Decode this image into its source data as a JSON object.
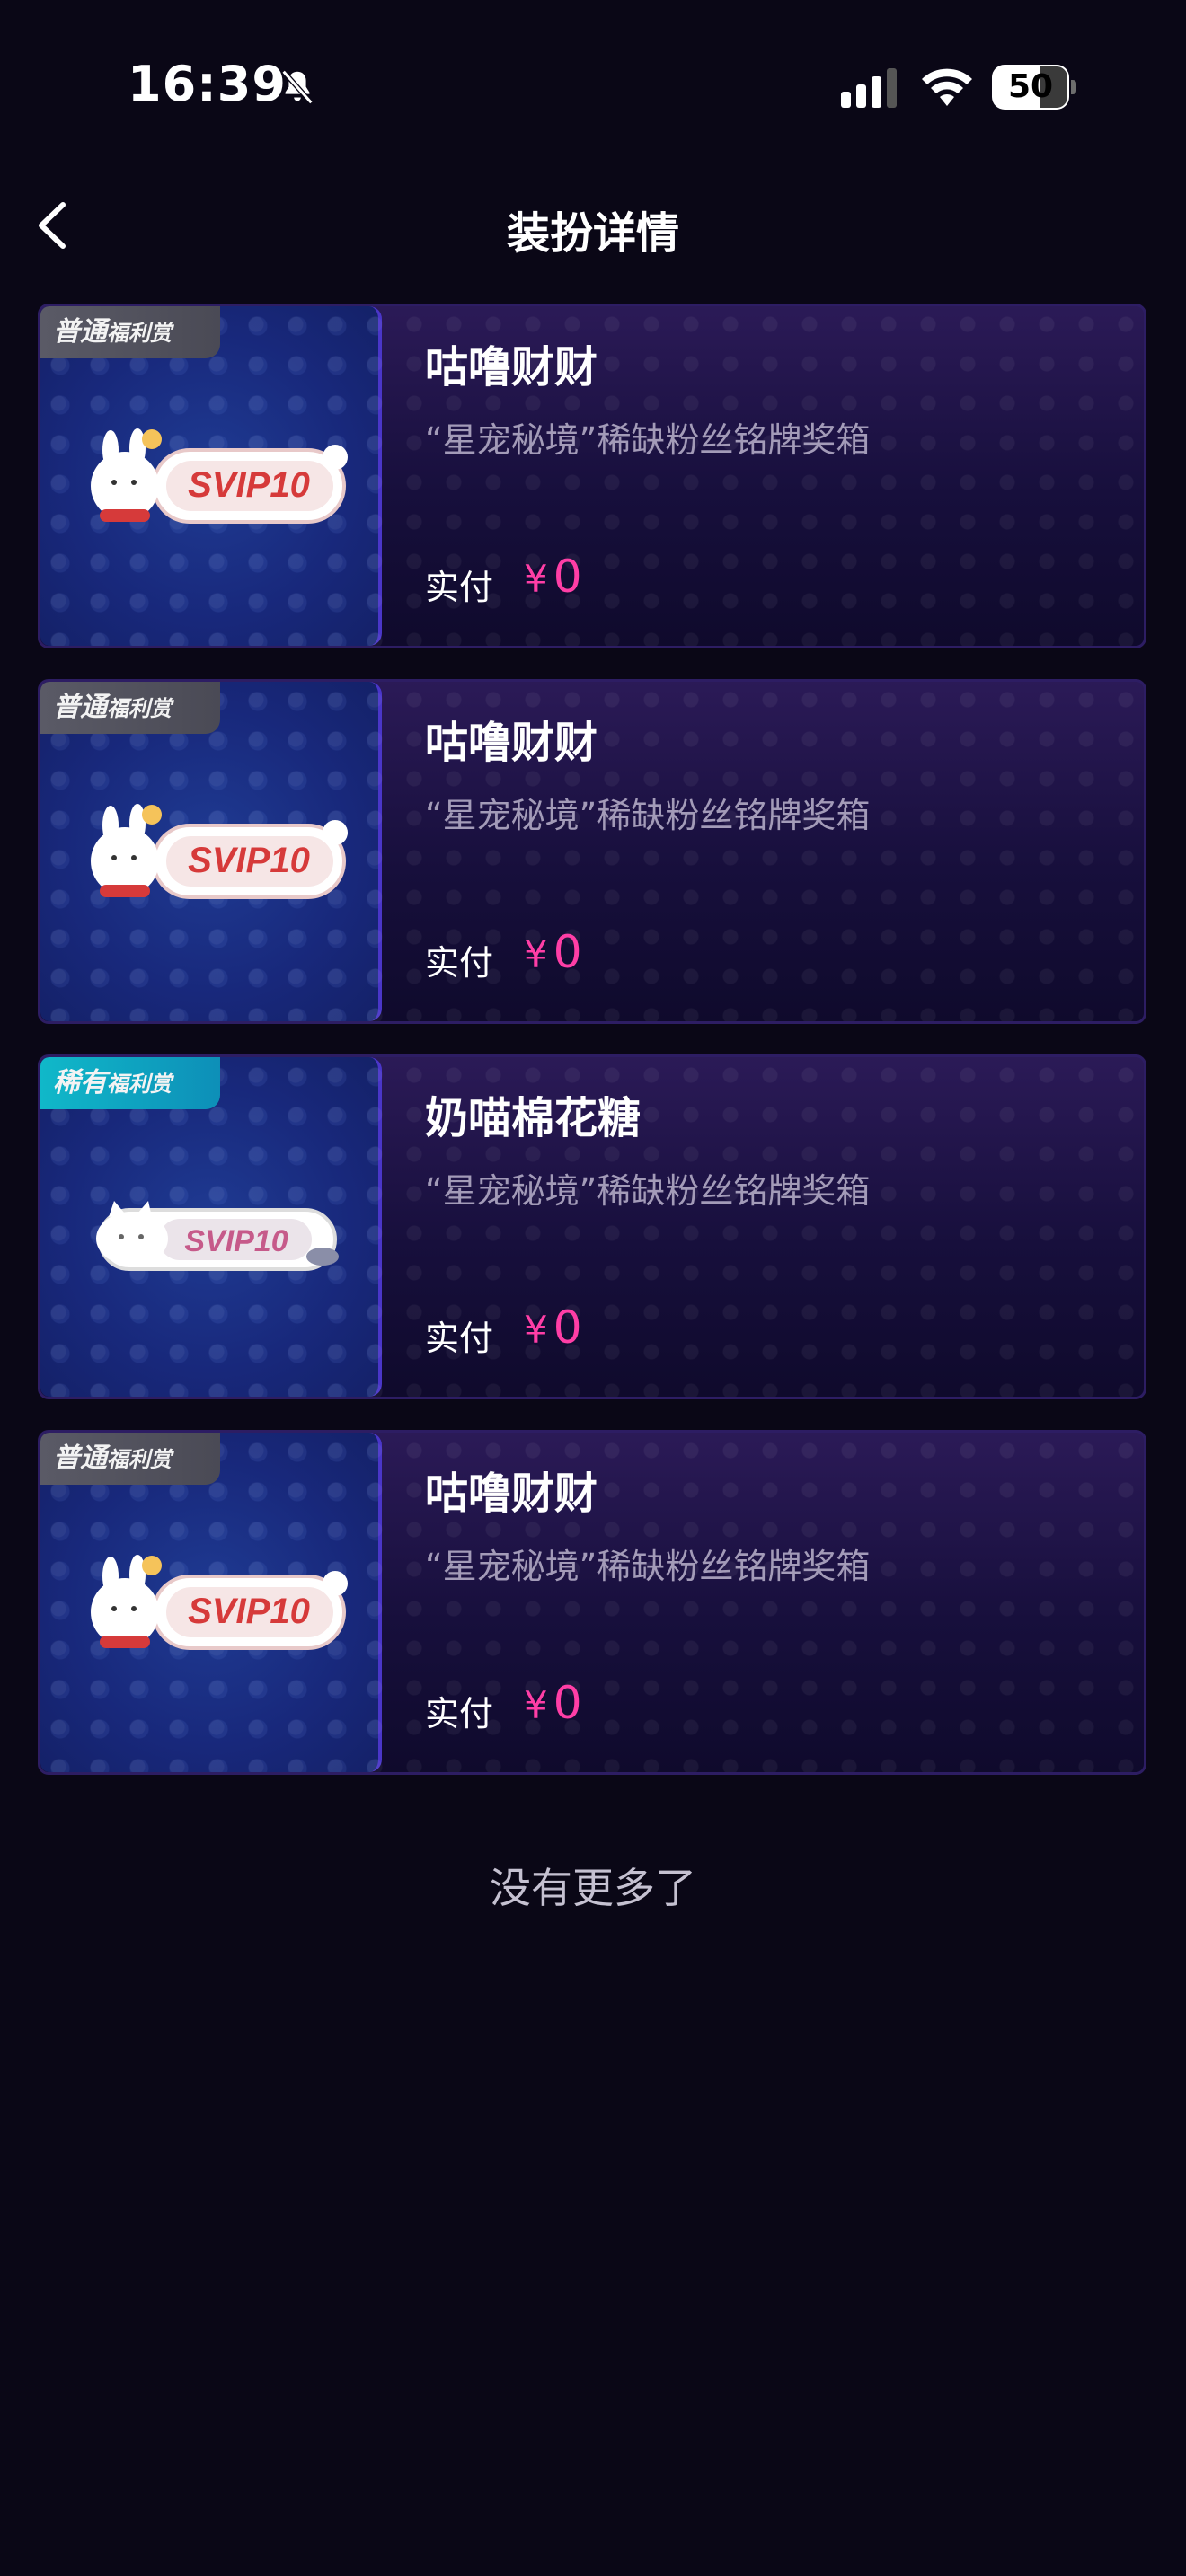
{
  "status_bar": {
    "time": "16:39",
    "battery_level": "50"
  },
  "header": {
    "title": "装扮详情"
  },
  "items": [
    {
      "tier": "普通",
      "tier_sub": "福利赏",
      "tier_type": "normal",
      "art_text": "SVIP10",
      "name": "咕噜财财",
      "source": "“星宠秘境”稀缺粉丝铭牌奖箱",
      "paid_label": "实付",
      "currency": "¥",
      "price": "0"
    },
    {
      "tier": "普通",
      "tier_sub": "福利赏",
      "tier_type": "normal",
      "art_text": "SVIP10",
      "name": "咕噜财财",
      "source": "“星宠秘境”稀缺粉丝铭牌奖箱",
      "paid_label": "实付",
      "currency": "¥",
      "price": "0"
    },
    {
      "tier": "稀有",
      "tier_sub": "福利赏",
      "tier_type": "rare",
      "art_text": "SVIP10",
      "name": "奶喵棉花糖",
      "source": "“星宠秘境”稀缺粉丝铭牌奖箱",
      "paid_label": "实付",
      "currency": "¥",
      "price": "0"
    },
    {
      "tier": "普通",
      "tier_sub": "福利赏",
      "tier_type": "normal",
      "art_text": "SVIP10",
      "name": "咕噜财财",
      "source": "“星宠秘境”稀缺粉丝铭牌奖箱",
      "paid_label": "实付",
      "currency": "¥",
      "price": "0"
    }
  ],
  "footer": {
    "end_text": "没有更多了"
  },
  "colors": {
    "background": "#0a0716",
    "price": "#ff3ea6",
    "rare_badge": "#10b8c9",
    "normal_badge": "#5a5a66"
  }
}
